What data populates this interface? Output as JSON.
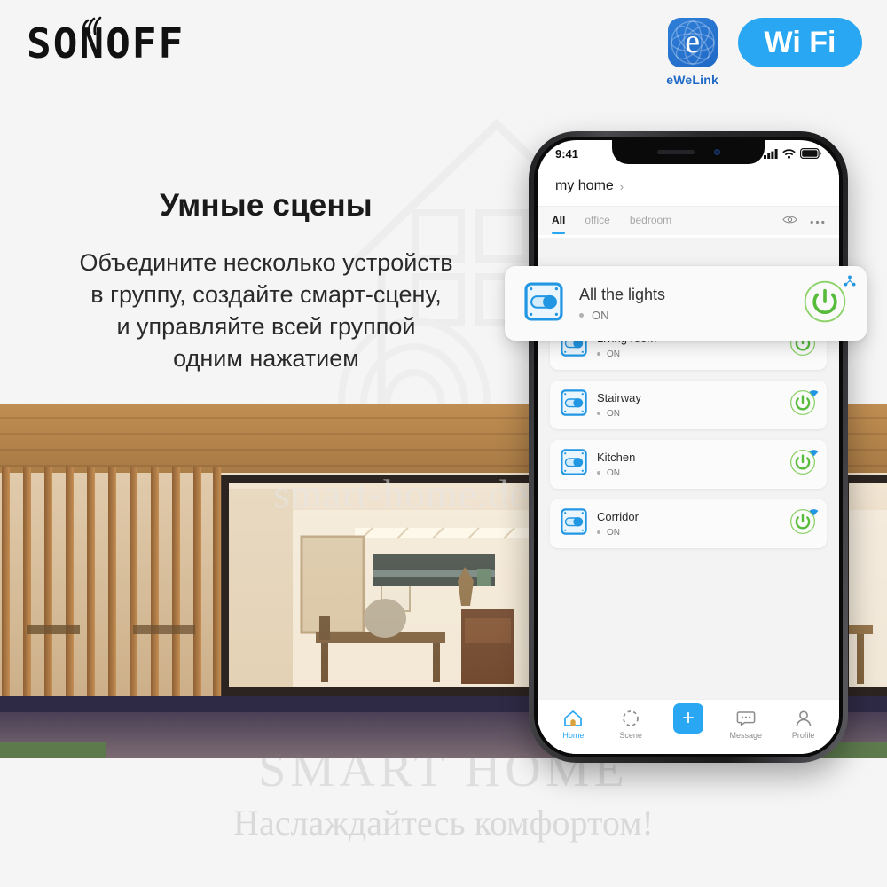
{
  "brand": {
    "logo_text": "SONOFF",
    "wave_icon": "wifi-wave-icon"
  },
  "badges": {
    "ewelink": {
      "icon": "ewelink-app-icon",
      "glyph": "e",
      "label": "eWeLink"
    },
    "wifi": {
      "icon": "wifi-badge-icon",
      "text": "Wi Fi"
    }
  },
  "copy": {
    "headline": "Умные сцены",
    "lines": [
      "Объедините несколько устройств",
      "в группу, создайте смарт-сцену,",
      "и управляйте всей группой",
      "одним нажатием"
    ]
  },
  "watermarks": {
    "middle": "smart-home.deal.by",
    "footer_title": "SMART HOME",
    "footer_sub": "Наслаждайтесь комфортом!"
  },
  "phone": {
    "statusbar": {
      "time": "9:41",
      "signal_icon": "cellular-signal-icon",
      "wifi_icon": "wifi-icon",
      "battery_icon": "battery-icon"
    },
    "header": {
      "home_name": "my home",
      "chevron": "›"
    },
    "tabs": [
      {
        "label": "All",
        "active": true
      },
      {
        "label": "office",
        "active": false
      },
      {
        "label": "bedroom",
        "active": false
      }
    ],
    "tab_actions": [
      {
        "icon": "eye-icon"
      },
      {
        "icon": "more-options-icon"
      }
    ],
    "group_card": {
      "name": "All the lights",
      "state": "ON",
      "device_icon": "smart-switch-icon",
      "power_icon": "power-button-icon",
      "corner_icon": "device-group-icon"
    },
    "devices": [
      {
        "name": "Living room",
        "state": "ON",
        "device_icon": "smart-switch-icon",
        "power_icon": "power-button-icon",
        "wifi_icon": "wifi-signal-icon"
      },
      {
        "name": "Stairway",
        "state": "ON",
        "device_icon": "smart-switch-icon",
        "power_icon": "power-button-icon",
        "wifi_icon": "wifi-signal-icon"
      },
      {
        "name": "Kitchen",
        "state": "ON",
        "device_icon": "smart-switch-icon",
        "power_icon": "power-button-icon",
        "wifi_icon": "wifi-signal-icon"
      },
      {
        "name": "Corridor",
        "state": "ON",
        "device_icon": "smart-switch-icon",
        "power_icon": "power-button-icon",
        "wifi_icon": "wifi-signal-icon"
      }
    ],
    "bottom_nav": [
      {
        "label": "Home",
        "icon": "home-icon",
        "active": true
      },
      {
        "label": "Scene",
        "icon": "scene-icon",
        "active": false
      },
      {
        "label": "",
        "icon": "add-icon",
        "active": false,
        "is_plus": true,
        "glyph": "+"
      },
      {
        "label": "Message",
        "icon": "message-icon",
        "active": false
      },
      {
        "label": "Profile",
        "icon": "profile-icon",
        "active": false
      }
    ]
  },
  "colors": {
    "accent_blue": "#29a7f2",
    "brand_blue": "#1f69c6",
    "device_blue": "#2196e3",
    "power_green": "#6cc24a",
    "background": "#f5f5f5"
  }
}
